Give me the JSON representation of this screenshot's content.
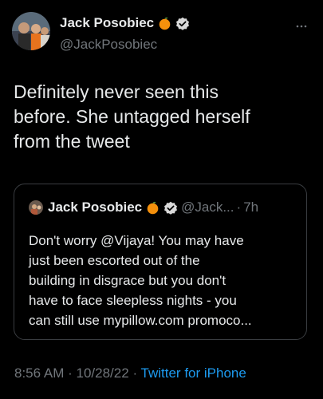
{
  "author": {
    "name": "Jack Posobiec",
    "handle": "@JackPosobiec",
    "avatar_icon": "profile-photo",
    "badge_icons": [
      "orange-fruit-icon",
      "verified-badge-icon"
    ]
  },
  "menu_icon": "more-options-icon",
  "tweet": {
    "text": "Definitely never seen this\nbefore. She untagged herself\nfrom the tweet"
  },
  "quoted": {
    "name": "Jack Posobiec",
    "handle": "@Jack...",
    "separator": "·",
    "time": "7h",
    "text": "Don't worry @Vijaya! You may have\njust been escorted out of the\nbuilding in disgrace but you don't\nhave to face sleepless nights - you\ncan still use mypillow.com promoco..."
  },
  "meta": {
    "time": "8:56 AM",
    "separator": "·",
    "date": "10/28/22",
    "source": "Twitter for iPhone"
  },
  "colors": {
    "background": "#000000",
    "text": "#e7e9ea",
    "muted": "#71767b",
    "link": "#1d9bf0",
    "verified": "#d9d9d9",
    "orange": "#f4900c"
  }
}
